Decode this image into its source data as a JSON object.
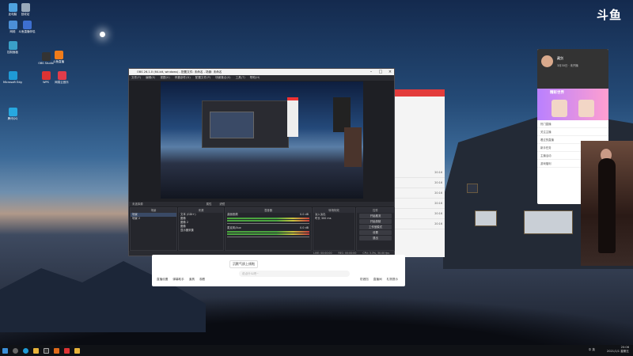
{
  "brand": "斗鱼",
  "desktop_icons": [
    {
      "label": "此电脑",
      "color": "#4fa3e0"
    },
    {
      "label": "回收站",
      "color": "#9ab"
    },
    {
      "label": "网络",
      "color": "#4c8fd6"
    },
    {
      "label": "斗鱼直播伴侣",
      "color": "#3d6fd0"
    },
    {
      "label": "控制面板",
      "color": "#3aa0c8"
    },
    {
      "label": "OBS Studio",
      "color": "#333"
    },
    {
      "label": "斗鱼直播",
      "color": "#f07c1a"
    },
    {
      "label": "Microsoft Edge",
      "color": "#1f9ad6"
    },
    {
      "label": "WPS",
      "color": "#d33"
    },
    {
      "label": "网易云音乐",
      "color": "#e03c4a"
    },
    {
      "label": "腾讯QQ",
      "color": "#27a8e0"
    }
  ],
  "obs": {
    "title": "OBS 26.1.0 (64-bit, windows) - 配置文件: 未命名 - 场景: 未命名",
    "menu": [
      "文件(F)",
      "编辑(E)",
      "视图(V)",
      "停靠部件(D)",
      "配置文件(P)",
      "场景集合(S)",
      "工具(T)",
      "帮助(H)"
    ],
    "no_source_label": "未选择源",
    "properties_label": "属性",
    "filters_label": "滤镜",
    "panels": {
      "scenes": "场景",
      "sources": "来源",
      "mixer": "混音器",
      "transitions": "转场特效",
      "controls": "控件"
    },
    "scenes": [
      "场景",
      "场景 2"
    ],
    "sources": [
      "文本 (GDI+)",
      "图像",
      "图像 2",
      "图像",
      "显示器采集"
    ],
    "mixer": [
      {
        "name": "桌面音频",
        "db": "0.0 dB"
      },
      {
        "name": "麦克风/Aux",
        "db": "0.0 dB"
      }
    ],
    "transition": {
      "type": "淡入淡出",
      "duration_label": "时长",
      "duration": "300 ms"
    },
    "controls": [
      "开始推流",
      "开始录制",
      "工作室模式",
      "设置",
      "退出"
    ],
    "status": [
      "LIVE: 00:00:00",
      "REC: 00:00:00",
      "CPU: 3.3%, 30.00 fps"
    ]
  },
  "comment_bar": {
    "tip": "沉默气质上线啦",
    "placeholder": "说点什么吧~",
    "bottom_items": [
      "直播设置",
      "弹幕助手",
      "道具",
      "观看"
    ],
    "right_items": [
      "防遮挡",
      "直播间",
      "礼物提示"
    ]
  },
  "side_list_times": [
    "20:16",
    "20:16",
    "20:16",
    "20:16",
    "20:16",
    "20:16"
  ],
  "chat": {
    "username": "藏剑",
    "status": "3月30日 · 未开播",
    "banner": "精彩世界",
    "items": [
      "热门直播",
      "关注主播",
      "看过的直播",
      "新手任务",
      "主播活动",
      "游戏福利"
    ]
  },
  "taskbar": {
    "time": "20:06",
    "date": "2021/1/1 星期五",
    "ime": "中",
    "volume": "",
    "lang": "英"
  }
}
